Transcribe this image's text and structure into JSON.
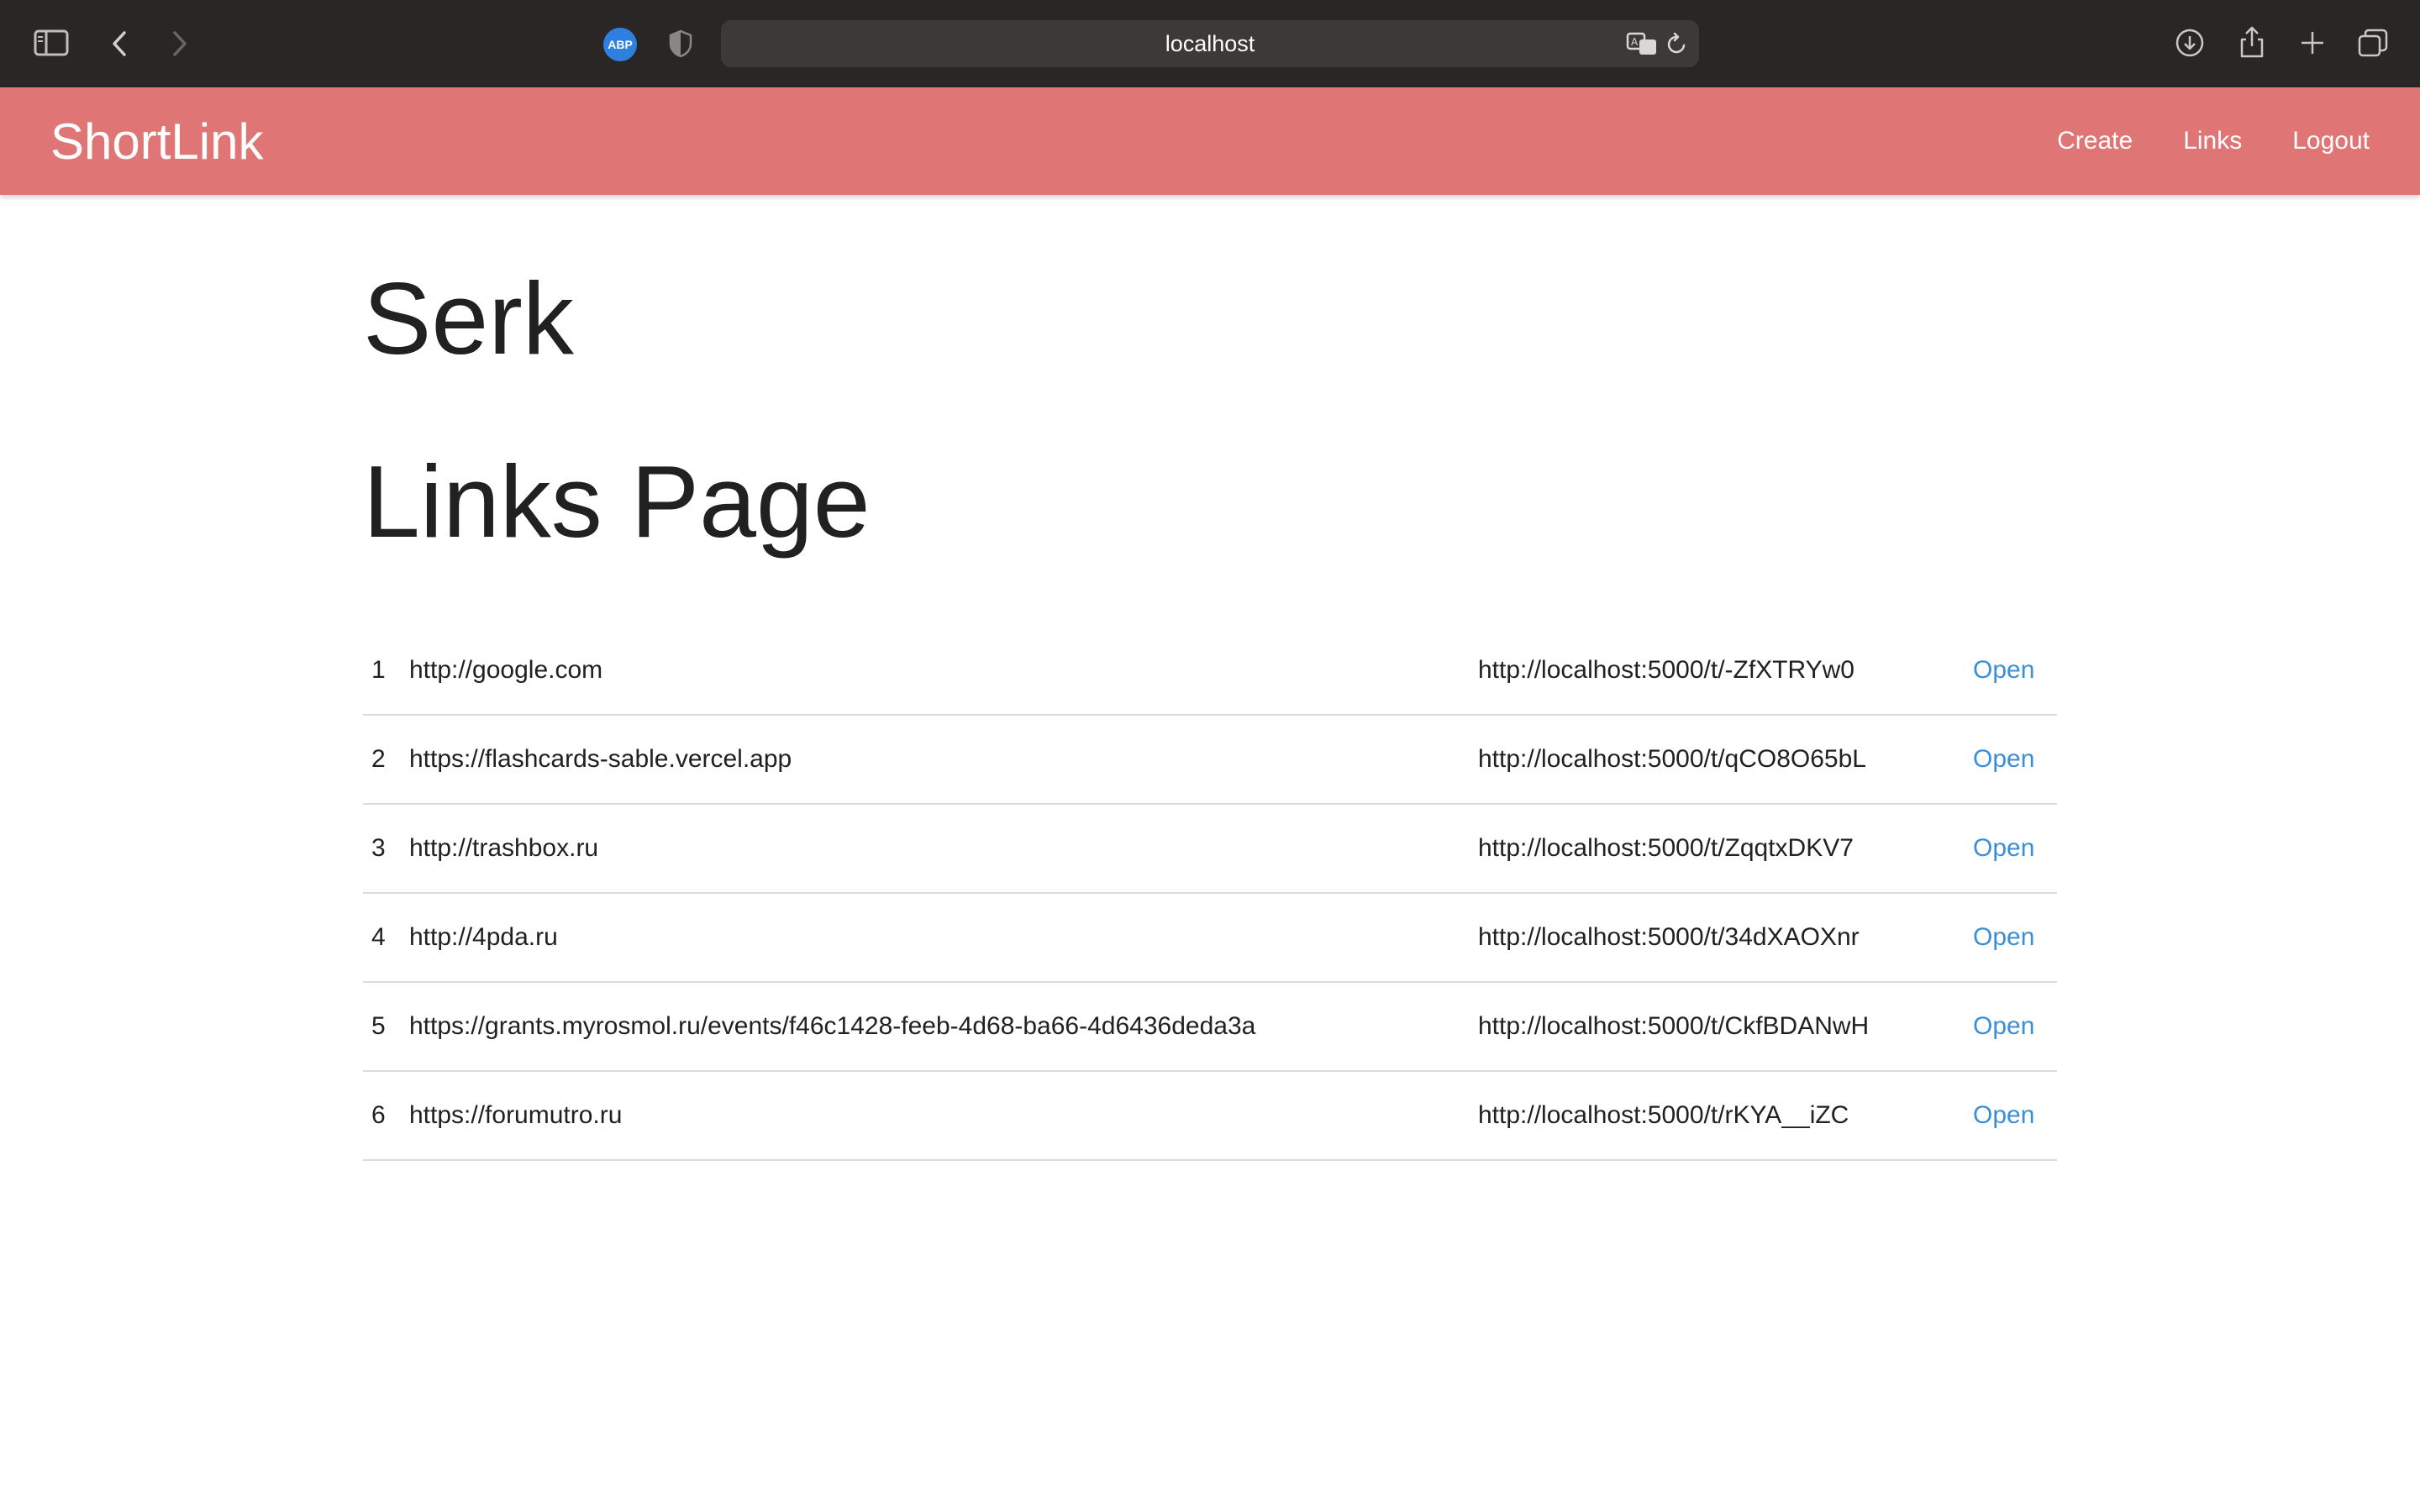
{
  "browser": {
    "url": "localhost",
    "abp_label": "ABP",
    "icons": [
      "sidebar-icon",
      "back-icon",
      "forward-icon",
      "shield-icon",
      "translate-icon",
      "reload-icon",
      "download-icon",
      "share-icon",
      "new-tab-icon",
      "tabs-overview-icon"
    ]
  },
  "navbar": {
    "brand": "ShortLink",
    "links": [
      "Create",
      "Links",
      "Logout"
    ],
    "color": "#e07575"
  },
  "main": {
    "user_name": "Serk",
    "page_title": "Links Page",
    "links": [
      {
        "num": "1",
        "original": "http://google.com",
        "short": "http://localhost:5000/t/-ZfXTRYw0",
        "action": "Open"
      },
      {
        "num": "2",
        "original": "https://flashcards-sable.vercel.app",
        "short": "http://localhost:5000/t/qCO8O65bL",
        "action": "Open"
      },
      {
        "num": "3",
        "original": "http://trashbox.ru",
        "short": "http://localhost:5000/t/ZqqtxDKV7",
        "action": "Open"
      },
      {
        "num": "4",
        "original": "http://4pda.ru",
        "short": "http://localhost:5000/t/34dXAOXnr",
        "action": "Open"
      },
      {
        "num": "5",
        "original": "https://grants.myrosmol.ru/events/f46c1428-feeb-4d68-ba66-4d6436deda3a",
        "short": "http://localhost:5000/t/CkfBDANwH",
        "action": "Open"
      },
      {
        "num": "6",
        "original": "https://forumutro.ru",
        "short": "http://localhost:5000/t/rKYA__iZC",
        "action": "Open"
      }
    ],
    "link_color": "#3a8fd8"
  }
}
